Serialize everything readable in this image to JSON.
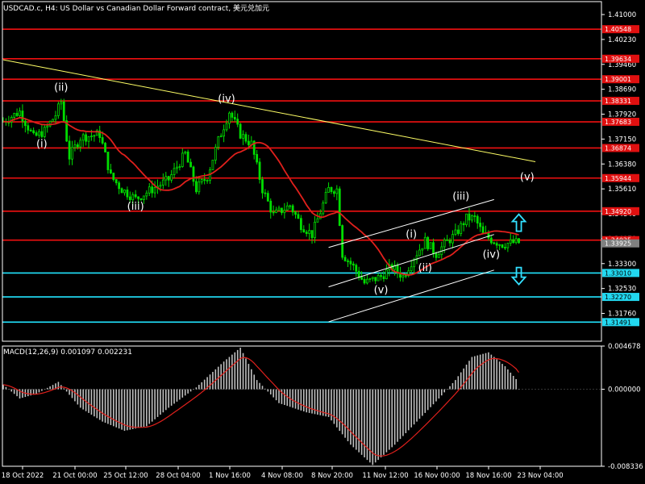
{
  "header": {
    "title": "USDCAD.c, H4:  US Dollar vs Canadian Dollar Forward contract, 美元兑加元"
  },
  "chart_data": [
    {
      "type": "candlestick",
      "panel": "price",
      "ylim": [
        1.309,
        1.414
      ],
      "y_ticks": [
        "1.41000",
        "1.40230",
        "1.39460",
        "1.38690",
        "1.37920",
        "1.37150",
        "1.36380",
        "1.35610",
        "1.34840",
        "1.34070",
        "1.33300",
        "1.32530",
        "1.31760"
      ],
      "x_ticks": [
        "18 Oct 2022",
        "21 Oct 00:00",
        "25 Oct 12:00",
        "28 Oct 04:00",
        "1 Nov 16:00",
        "4 Nov 08:00",
        "8 Nov 20:00",
        "11 Nov 12:00",
        "16 Nov 00:00",
        "18 Nov 16:00",
        "23 Nov 04:00"
      ],
      "current_price": "1.34025",
      "current_price_2": "1.33925",
      "red_levels": [
        "1.40548",
        "1.39634",
        "1.39001",
        "1.38331",
        "1.37683",
        "1.36874",
        "1.35944",
        "1.34920",
        "1.34025"
      ],
      "cyan_levels": [
        "1.33010",
        "1.32270",
        "1.31491"
      ],
      "wave_labels": [
        {
          "text": "(ii)",
          "x": 21,
          "y": 1.3865
        },
        {
          "text": "(i)",
          "x": 14,
          "y": 1.369
        },
        {
          "text": "(iii)",
          "x": 48,
          "y": 1.3497
        },
        {
          "text": "(iv)",
          "x": 81,
          "y": 1.3829
        },
        {
          "text": "(v)",
          "x": 137,
          "y": 1.3238
        },
        {
          "text": "(i)",
          "x": 148,
          "y": 1.341
        },
        {
          "text": "(ii)",
          "x": 153,
          "y": 1.3307
        },
        {
          "text": "(iii)",
          "x": 166,
          "y": 1.3528
        },
        {
          "text": "(iv)",
          "x": 177,
          "y": 1.3348
        },
        {
          "text": "(v)",
          "x": 190,
          "y": 1.3588
        }
      ],
      "lines": [
        {
          "name": "trendline",
          "color": "#ffff66",
          "points": [
            [
              0,
              1.396
            ],
            [
              193,
              1.3645
            ]
          ]
        },
        {
          "name": "channel-upper",
          "color": "#ffffff",
          "points": [
            [
              118,
              1.338
            ],
            [
              178,
              1.3528
            ]
          ]
        },
        {
          "name": "channel-mid",
          "color": "#ffffff",
          "points": [
            [
              118,
              1.3258
            ],
            [
              178,
              1.342
            ]
          ]
        },
        {
          "name": "channel-lower",
          "color": "#ffffff",
          "points": [
            [
              118,
              1.315
            ],
            [
              178,
              1.331
            ]
          ]
        }
      ],
      "ma_color": "#e0201c",
      "candle_color": "#00dd00",
      "arrows": [
        {
          "dir": "up",
          "color": "#33e0ff",
          "x": 187,
          "y": 1.3455
        },
        {
          "dir": "down",
          "color": "#33e0ff",
          "x": 187,
          "y": 1.3293
        }
      ]
    },
    {
      "type": "histogram",
      "panel": "macd",
      "title": "MACD(12,26,9) 0.001097 0.002231",
      "ylim": [
        -0.008336,
        0.004678
      ],
      "y_ticks": [
        "0.004678",
        "0.000000",
        "-0.008336"
      ],
      "histogram_color": "#c0c0c0",
      "signal_color": "#e0201c"
    }
  ]
}
